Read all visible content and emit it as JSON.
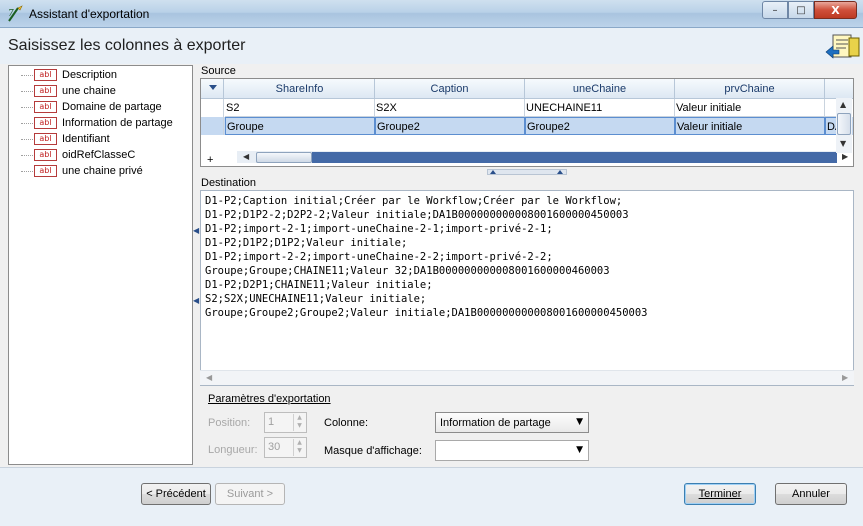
{
  "window": {
    "title": "Assistant d'exportation",
    "controls": {
      "minimize": "–",
      "maximize": "□",
      "close": "X"
    }
  },
  "header": {
    "title": "Saisissez les colonnes à exporter"
  },
  "fields": {
    "badge": "abl",
    "items": [
      "Description",
      "une chaine",
      "Domaine de partage",
      "Information de partage",
      "Identifiant",
      "oidRefClasseC",
      "une chaine privé"
    ]
  },
  "source": {
    "label": "Source",
    "columns": [
      "ShareInfo",
      "Caption",
      "uneChaine",
      "prvChaine"
    ],
    "rows": [
      [
        "S2",
        "S2X",
        "UNECHAINE11",
        "Valeur initiale",
        ""
      ],
      [
        "Groupe",
        "Groupe2",
        "Groupe2",
        "Valeur initiale",
        "DA"
      ]
    ],
    "add_row": "+"
  },
  "destination": {
    "label": "Destination",
    "lines": [
      "D1-P2;Caption initial;Créer par le Workflow;Créer par le Workflow;",
      "D1-P2;D1P2-2;D2P2-2;Valeur initiale;DA1B000000000008001600000450003",
      "D1-P2;import-2-1;import-uneChaine-2-1;import-privé-2-1;",
      "D1-P2;D1P2;D1P2;Valeur initiale;",
      "D1-P2;import-2-2;import-uneChaine-2-2;import-privé-2-2;",
      "Groupe;Groupe;CHAINE11;Valeur 32;DA1B000000000008001600000460003",
      "D1-P2;D2P1;CHAINE11;Valeur initiale;",
      "S2;S2X;UNECHAINE11;Valeur initiale;",
      "Groupe;Groupe2;Groupe2;Valeur initiale;DA1B000000000008001600000450003"
    ]
  },
  "params": {
    "title": "Paramètres d'exportation",
    "position_label": "Position:",
    "position_value": "1",
    "length_label": "Longueur:",
    "length_value": "30",
    "column_label": "Colonne:",
    "column_value": "Information de partage",
    "mask_label": "Masque d'affichage:",
    "mask_value": ""
  },
  "buttons": {
    "prev": "< Précédent",
    "next": "Suivant >",
    "finish": "Terminer",
    "cancel": "Annuler"
  },
  "colors": {
    "selection": "#c5d9f1",
    "accent": "#446aa7",
    "badge_red": "#c02020"
  }
}
